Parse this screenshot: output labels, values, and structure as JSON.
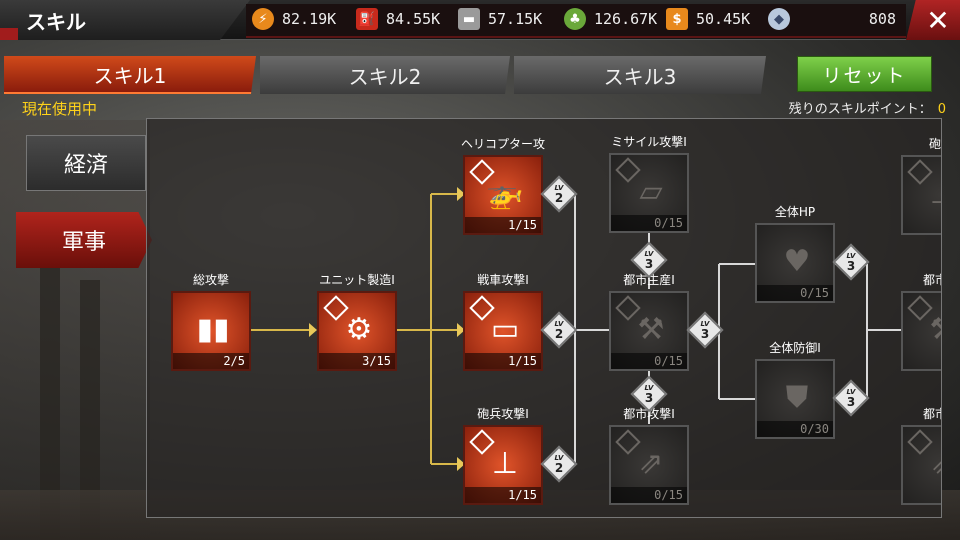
{
  "header": {
    "title": "スキル",
    "close_icon": "close-icon"
  },
  "resources": [
    {
      "icon": "lightning-icon",
      "color": "#e8891c",
      "glyph": "⚡",
      "value": "82.19K"
    },
    {
      "icon": "oil-barrel-icon",
      "color": "#c82a1c",
      "glyph": "⛽",
      "value": "84.55K"
    },
    {
      "icon": "steel-icon",
      "color": "#9a9a9a",
      "glyph": "▬",
      "value": "57.15K"
    },
    {
      "icon": "food-icon",
      "color": "#6aa83a",
      "glyph": "♣",
      "value": "126.67K"
    },
    {
      "icon": "money-icon",
      "color": "#e8891c",
      "glyph": "$",
      "value": "50.45K"
    },
    {
      "icon": "diamond-icon",
      "color": "#b8c8dc",
      "glyph": "◆",
      "value": "808"
    }
  ],
  "tabs": [
    {
      "label": "スキル1",
      "active": true
    },
    {
      "label": "スキル2",
      "active": false
    },
    {
      "label": "スキル3",
      "active": false
    }
  ],
  "reset_label": "リセット",
  "in_use_label": "現在使用中",
  "points": {
    "label": "残りのスキルポイント：",
    "value": "0"
  },
  "categories": [
    {
      "label": "経済",
      "active": false
    },
    {
      "label": "軍事",
      "active": true
    }
  ],
  "lv_prefix": "LV",
  "nodes": [
    {
      "id": "general-attack",
      "label": "総攻撃",
      "count": "2/5",
      "state": "unlocked",
      "icon": "shell-icon",
      "glyph": "▮▮"
    },
    {
      "id": "unit-production",
      "label": "ユニット製造I",
      "count": "3/15",
      "state": "unlocked",
      "icon": "gears-icon",
      "glyph": "⚙"
    },
    {
      "id": "helicopter-attack",
      "label": "ヘリコプター攻",
      "count": "1/15",
      "state": "unlocked",
      "icon": "helicopter-icon",
      "glyph": "🚁",
      "lv": "2"
    },
    {
      "id": "tank-attack",
      "label": "戦車攻撃I",
      "count": "1/15",
      "state": "unlocked",
      "icon": "tank-icon",
      "glyph": "▭",
      "lv": "2"
    },
    {
      "id": "artillery-attack",
      "label": "砲兵攻撃I",
      "count": "1/15",
      "state": "unlocked",
      "icon": "artillery-icon",
      "glyph": "⊥",
      "lv": "2"
    },
    {
      "id": "missile-attack",
      "label": "ミサイル攻撃I",
      "count": "0/15",
      "state": "locked",
      "icon": "missile-truck-icon",
      "glyph": "▱",
      "lv": "3"
    },
    {
      "id": "city-production",
      "label": "都市生産I",
      "count": "0/15",
      "state": "locked",
      "icon": "wrench-icon",
      "glyph": "⚒",
      "lv": "3"
    },
    {
      "id": "city-attack",
      "label": "都市攻撃I",
      "count": "0/15",
      "state": "locked",
      "icon": "missiles-icon",
      "glyph": "⇗",
      "lv": "3"
    },
    {
      "id": "total-hp",
      "label": "全体HP",
      "count": "0/15",
      "state": "locked",
      "icon": "heart-icon",
      "glyph": "♥",
      "lv": "3"
    },
    {
      "id": "total-defense",
      "label": "全体防御I",
      "count": "0/30",
      "state": "locked",
      "icon": "shield-icon",
      "glyph": "⛊",
      "lv": "3"
    },
    {
      "id": "artillery-partial",
      "label": "砲撃",
      "state": "locked",
      "icon": "artillery-icon",
      "glyph": "⊥"
    },
    {
      "id": "city-partial-1",
      "label": "都市生",
      "state": "locked",
      "icon": "wrench-icon",
      "glyph": "⚒"
    },
    {
      "id": "city-partial-2",
      "label": "都市攻",
      "state": "locked",
      "icon": "missiles-icon",
      "glyph": "⇗"
    }
  ]
}
